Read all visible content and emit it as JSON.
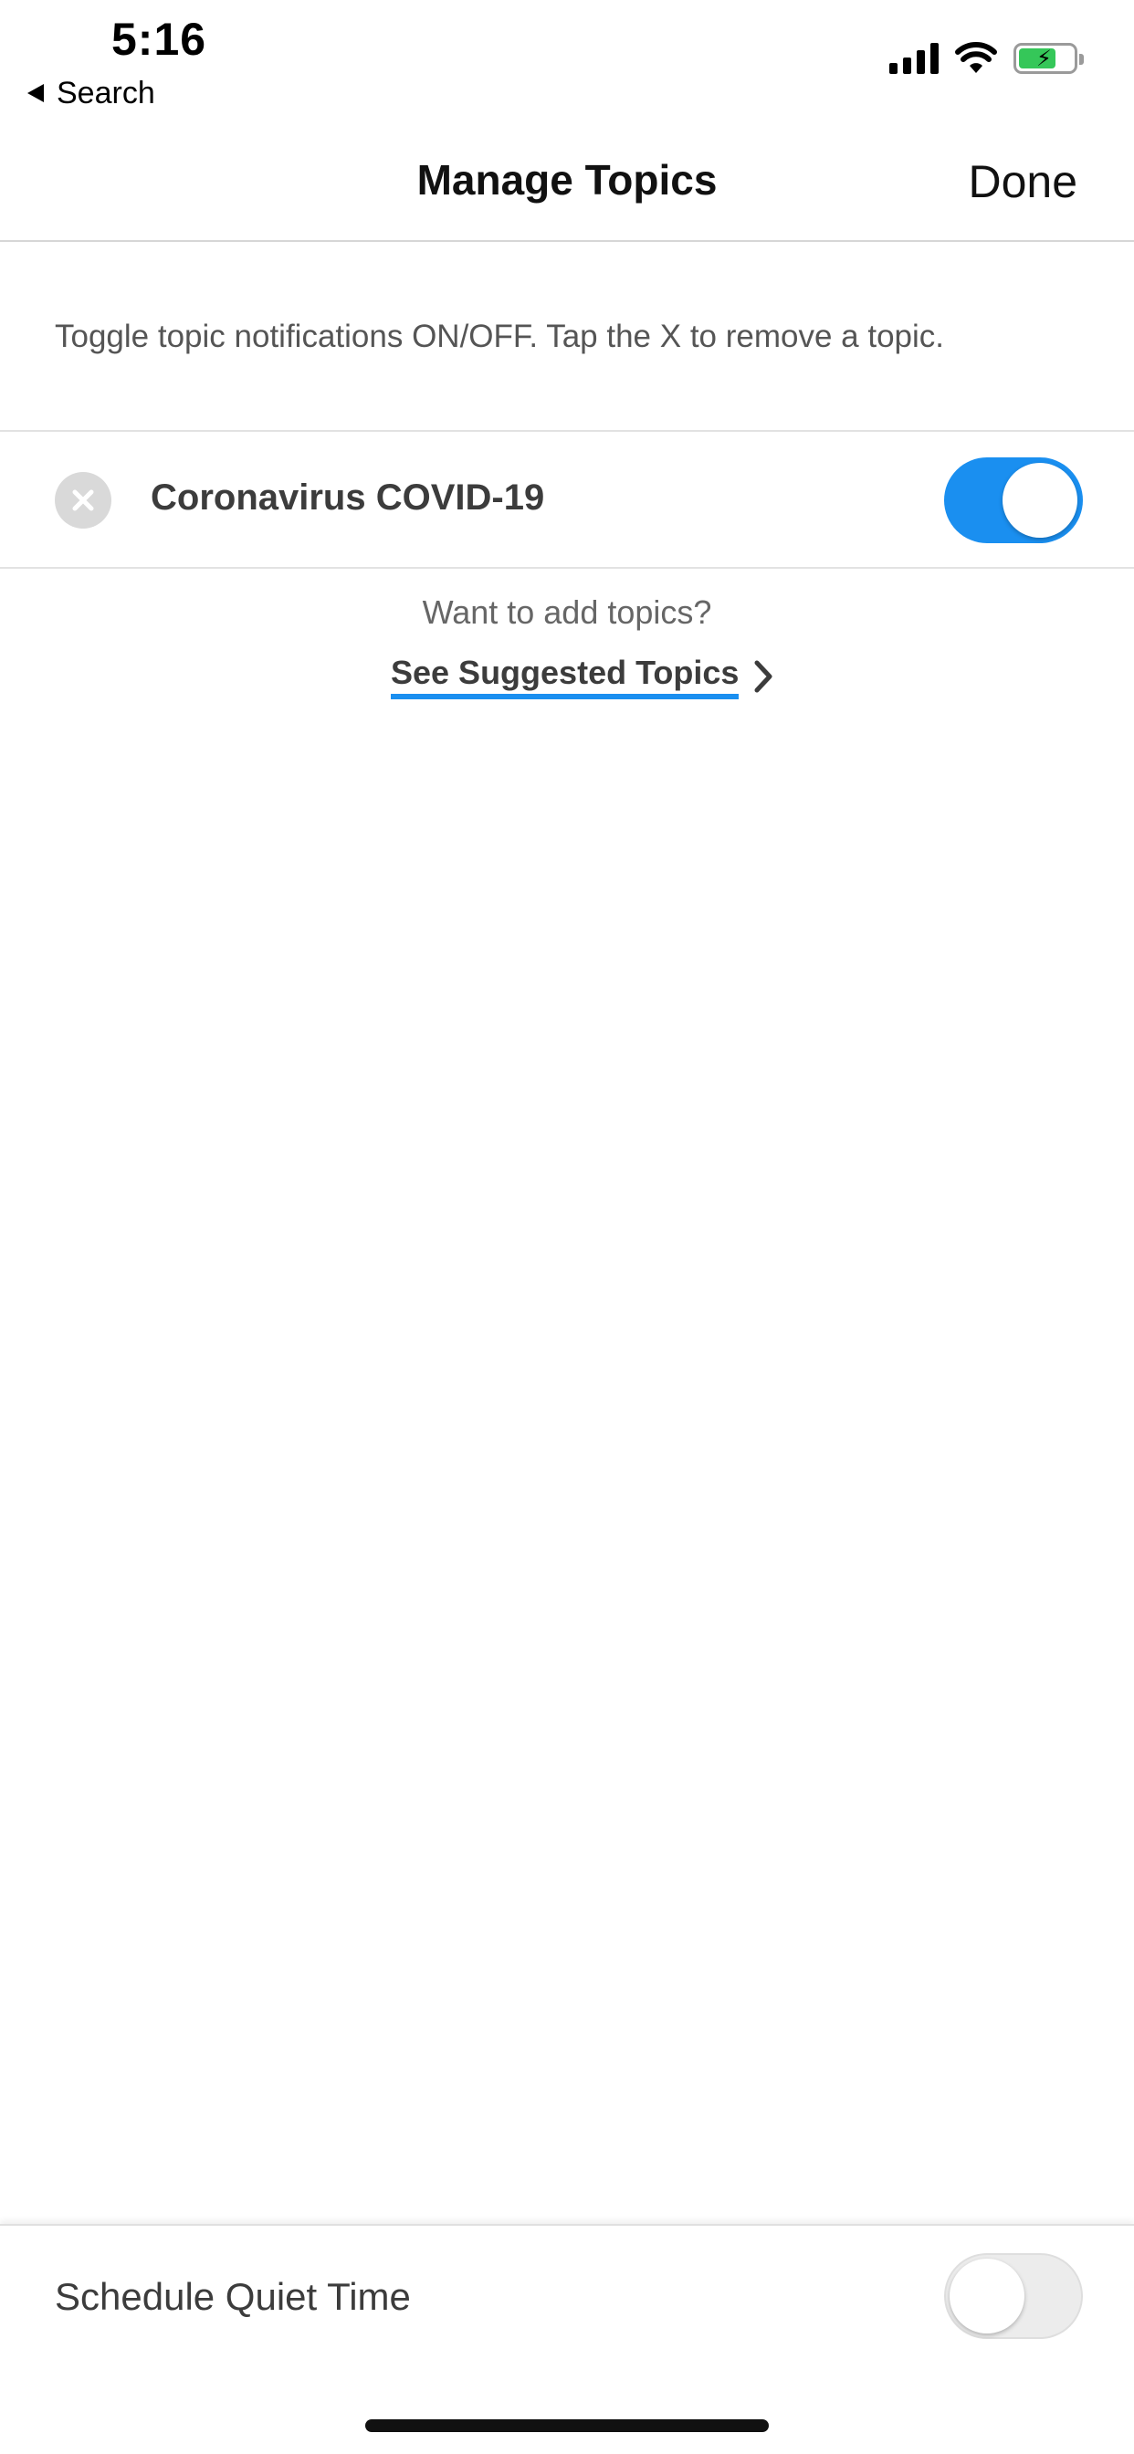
{
  "status_bar": {
    "time": "5:16",
    "back_label": "Search",
    "battery_color": "#35c759"
  },
  "nav": {
    "title": "Manage Topics",
    "done_label": "Done"
  },
  "instructions": "Toggle topic notifications ON/OFF. Tap the X to remove a topic.",
  "topics": [
    {
      "name": "Coronavirus COVID-19",
      "notifications_on": true
    }
  ],
  "add_topics": {
    "prompt": "Want to add topics?",
    "link_label": "See Suggested Topics"
  },
  "quiet_time": {
    "label": "Schedule Quiet Time",
    "enabled": false
  },
  "colors": {
    "accent": "#1a8ff0",
    "text": "#3c3c3c"
  }
}
